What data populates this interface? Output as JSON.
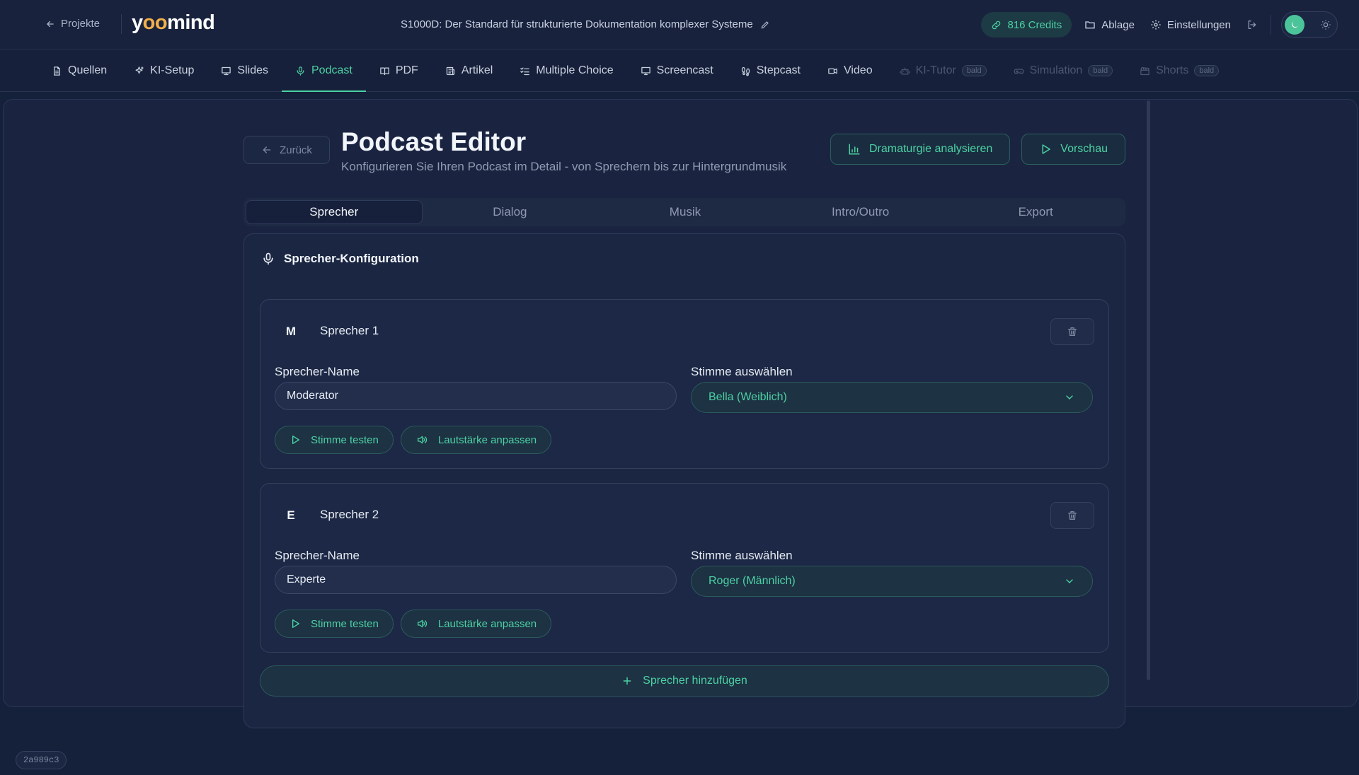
{
  "topbar": {
    "back_label": "Projekte",
    "logo": "yoomind",
    "project_title": "S1000D: Der Standard für strukturierte Dokumentation komplexer Systeme",
    "credits": "816 Credits",
    "archive_label": "Ablage",
    "settings_label": "Einstellungen"
  },
  "nav": {
    "items": [
      {
        "label": "Quellen",
        "icon": "document-icon"
      },
      {
        "label": "KI-Setup",
        "icon": "sparkles-icon"
      },
      {
        "label": "Slides",
        "icon": "presentation-icon"
      },
      {
        "label": "Podcast",
        "icon": "microphone-icon",
        "active": true
      },
      {
        "label": "PDF",
        "icon": "book-icon"
      },
      {
        "label": "Artikel",
        "icon": "newspaper-icon"
      },
      {
        "label": "Multiple Choice",
        "icon": "list-check-icon"
      },
      {
        "label": "Screencast",
        "icon": "monitor-icon"
      },
      {
        "label": "Stepcast",
        "icon": "footprints-icon"
      },
      {
        "label": "Video",
        "icon": "video-icon"
      },
      {
        "label": "KI-Tutor",
        "icon": "bot-icon",
        "badge": "bald"
      },
      {
        "label": "Simulation",
        "icon": "gamepad-icon",
        "badge": "bald"
      },
      {
        "label": "Shorts",
        "icon": "clapperboard-icon",
        "badge": "bald"
      }
    ]
  },
  "header": {
    "back_label": "Zurück",
    "title": "Podcast Editor",
    "subtitle": "Konfigurieren Sie Ihren Podcast im Detail - von Sprechern bis zur Hintergrundmusik",
    "analyze_label": "Dramaturgie analysieren",
    "preview_label": "Vorschau"
  },
  "tabs": [
    {
      "label": "Sprecher",
      "active": true
    },
    {
      "label": "Dialog"
    },
    {
      "label": "Musik"
    },
    {
      "label": "Intro/Outro"
    },
    {
      "label": "Export"
    }
  ],
  "config": {
    "title": "Sprecher-Konfiguration",
    "name_label": "Sprecher-Name",
    "voice_label": "Stimme auswählen",
    "test_label": "Stimme testen",
    "volume_label": "Lautstärke anpassen",
    "add_label": "Sprecher hinzufügen",
    "speakers": [
      {
        "initial": "M",
        "title": "Sprecher 1",
        "name": "Moderator",
        "voice": "Bella (Weiblich)"
      },
      {
        "initial": "E",
        "title": "Sprecher 2",
        "name": "Experte",
        "voice": "Roger (Männlich)"
      }
    ]
  },
  "version": "2a989c3",
  "colors": {
    "accent": "#4cd1a3",
    "background": "#15203a",
    "surface": "#1b2642"
  }
}
